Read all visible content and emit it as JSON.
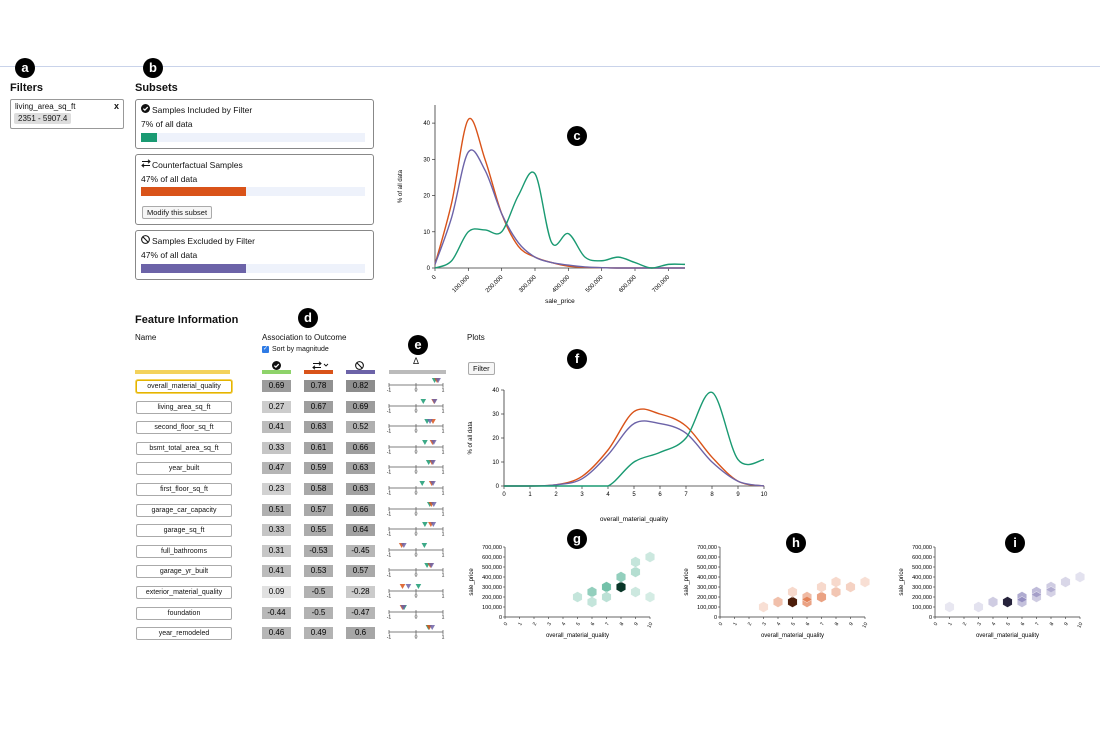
{
  "badges": {
    "a": "a",
    "b": "b",
    "c": "c",
    "d": "d",
    "e": "e",
    "f": "f",
    "g": "g",
    "h": "h",
    "i": "i"
  },
  "filters": {
    "title": "Filters",
    "item": {
      "name": "living_area_sq_ft",
      "range": "2351 - 5907.4",
      "close": "x"
    }
  },
  "subsets": {
    "title": "Subsets",
    "included": {
      "title": "Samples Included by Filter",
      "pct_label": "7% of all data",
      "pct": 7,
      "color": "#1a9a72"
    },
    "counterfactual": {
      "title": "Counterfactual Samples",
      "pct_label": "47% of all data",
      "pct": 47,
      "color": "#d95319",
      "button": "Modify this subset"
    },
    "excluded": {
      "title": "Samples Excluded by Filter",
      "pct_label": "47% of all data",
      "pct": 47,
      "color": "#6c63a8"
    }
  },
  "colors": {
    "included": "#1a9a72",
    "counterfactual": "#d95319",
    "excluded": "#6c63a8",
    "selected": "#f3d25c"
  },
  "feature_info": {
    "title": "Feature Information",
    "name_header": "Name",
    "assoc_header": "Association to Outcome",
    "sort_label": "Sort by magnitude",
    "sort_checked": true,
    "delta_header": "Δ",
    "plots_header": "Plots",
    "filter_button": "Filter",
    "included_icon": "check-circle-icon",
    "counterfactual_icon": "swap-arrows-icon",
    "excluded_icon": "ban-icon",
    "axis": {
      "min": "-1",
      "zero": "0",
      "max": "1"
    },
    "rows": [
      {
        "name": "overall_material_quality",
        "inc": "0.69",
        "cf": "0.78",
        "exc": "0.82"
      },
      {
        "name": "living_area_sq_ft",
        "inc": "0.27",
        "cf": "0.67",
        "exc": "0.69"
      },
      {
        "name": "second_floor_sq_ft",
        "inc": "0.41",
        "cf": "0.63",
        "exc": "0.52"
      },
      {
        "name": "bsmt_total_area_sq_ft",
        "inc": "0.33",
        "cf": "0.61",
        "exc": "0.66"
      },
      {
        "name": "year_built",
        "inc": "0.47",
        "cf": "0.59",
        "exc": "0.63"
      },
      {
        "name": "first_floor_sq_ft",
        "inc": "0.23",
        "cf": "0.58",
        "exc": "0.63"
      },
      {
        "name": "garage_car_capacity",
        "inc": "0.51",
        "cf": "0.57",
        "exc": "0.66"
      },
      {
        "name": "garage_sq_ft",
        "inc": "0.33",
        "cf": "0.55",
        "exc": "0.64"
      },
      {
        "name": "full_bathrooms",
        "inc": "0.31",
        "cf": "-0.53",
        "exc": "-0.45"
      },
      {
        "name": "garage_yr_built",
        "inc": "0.41",
        "cf": "0.53",
        "exc": "0.57"
      },
      {
        "name": "exterior_material_quality",
        "inc": "0.09",
        "cf": "-0.5",
        "exc": "-0.28"
      },
      {
        "name": "foundation",
        "inc": "-0.44",
        "cf": "-0.5",
        "exc": "-0.47"
      },
      {
        "name": "year_remodeled",
        "inc": "0.46",
        "cf": "0.49",
        "exc": "0.6"
      }
    ]
  },
  "chart_data": [
    {
      "type": "line",
      "xlabel": "sale_price",
      "ylabel": "% of all data",
      "xlim": [
        0,
        750000
      ],
      "ylim": [
        0,
        45
      ],
      "x_ticks": [
        "0",
        "100,000",
        "200,000",
        "300,000",
        "400,000",
        "500,000",
        "600,000",
        "700,000"
      ],
      "y_ticks": [
        "0",
        "10",
        "20",
        "30",
        "40"
      ],
      "x": [
        0,
        50000,
        100000,
        150000,
        200000,
        250000,
        300000,
        350000,
        400000,
        450000,
        500000,
        550000,
        600000,
        650000,
        700000,
        750000
      ],
      "series": [
        {
          "color": "#d95319",
          "values": [
            1,
            18,
            41,
            30,
            15,
            6,
            3,
            1.5,
            0.5,
            0.2,
            0.1,
            0,
            0,
            0,
            0,
            0
          ]
        },
        {
          "color": "#6c63a8",
          "values": [
            1,
            14,
            32,
            27,
            15,
            7,
            3,
            1.5,
            0.8,
            0.3,
            0.1,
            0,
            0,
            0,
            0,
            0
          ]
        },
        {
          "color": "#1a9a72",
          "values": [
            0,
            2,
            10,
            10.5,
            10,
            20,
            26,
            7,
            9.5,
            3,
            2,
            3,
            1.5,
            0,
            1,
            1
          ]
        }
      ]
    },
    {
      "type": "line",
      "xlabel": "overall_material_quality",
      "ylabel": "% of all data",
      "xlim": [
        0,
        10
      ],
      "ylim": [
        0,
        40
      ],
      "x_ticks": [
        "0",
        "1",
        "2",
        "3",
        "4",
        "5",
        "6",
        "7",
        "8",
        "9",
        "10"
      ],
      "y_ticks": [
        "0",
        "10",
        "20",
        "30",
        "40"
      ],
      "x": [
        0,
        1,
        2,
        3,
        4,
        5,
        6,
        7,
        8,
        9,
        10
      ],
      "series": [
        {
          "color": "#d95319",
          "values": [
            0,
            0,
            0.5,
            4,
            15,
            31,
            30,
            25,
            12,
            2,
            0
          ]
        },
        {
          "color": "#6c63a8",
          "values": [
            0,
            0,
            0.5,
            3,
            13,
            26,
            26,
            22,
            10,
            2,
            0
          ]
        },
        {
          "color": "#1a9a72",
          "values": [
            0,
            0,
            0,
            0,
            0,
            10,
            14,
            20,
            39,
            11,
            11
          ]
        }
      ]
    },
    {
      "type": "heatmap",
      "color": "#1a9a72",
      "xlabel": "overall_material_quality",
      "ylabel": "sale_price",
      "xlim": [
        0,
        10
      ],
      "ylim": [
        0,
        700000
      ],
      "x_ticks": [
        "0",
        "1",
        "2",
        "3",
        "4",
        "5",
        "6",
        "7",
        "8",
        "9",
        "10"
      ],
      "y_ticks": [
        "0",
        "100,000",
        "200,000",
        "300,000",
        "400,000",
        "500,000",
        "600,000",
        "700,000"
      ],
      "cells": [
        {
          "x": 5,
          "y": 200000,
          "v": 0.2
        },
        {
          "x": 6,
          "y": 250000,
          "v": 0.5
        },
        {
          "x": 7,
          "y": 300000,
          "v": 0.7
        },
        {
          "x": 8,
          "y": 300000,
          "v": 1.0
        },
        {
          "x": 8,
          "y": 400000,
          "v": 0.5
        },
        {
          "x": 9,
          "y": 450000,
          "v": 0.3
        },
        {
          "x": 9,
          "y": 550000,
          "v": 0.2
        },
        {
          "x": 10,
          "y": 600000,
          "v": 0.15
        },
        {
          "x": 7,
          "y": 200000,
          "v": 0.25
        },
        {
          "x": 6,
          "y": 150000,
          "v": 0.2
        },
        {
          "x": 9,
          "y": 250000,
          "v": 0.15
        },
        {
          "x": 10,
          "y": 200000,
          "v": 0.1
        }
      ]
    },
    {
      "type": "heatmap",
      "color": "#d95319",
      "xlabel": "overall_material_quality",
      "ylabel": "sale_price",
      "xlim": [
        0,
        10
      ],
      "ylim": [
        0,
        700000
      ],
      "x_ticks": [
        "0",
        "1",
        "2",
        "3",
        "4",
        "5",
        "6",
        "7",
        "8",
        "9",
        "10"
      ],
      "y_ticks": [
        "0",
        "100,000",
        "200,000",
        "300,000",
        "400,000",
        "500,000",
        "600,000",
        "700,000"
      ],
      "cells": [
        {
          "x": 3,
          "y": 100000,
          "v": 0.1
        },
        {
          "x": 4,
          "y": 150000,
          "v": 0.35
        },
        {
          "x": 5,
          "y": 150000,
          "v": 1.0
        },
        {
          "x": 6,
          "y": 150000,
          "v": 0.6
        },
        {
          "x": 6,
          "y": 200000,
          "v": 0.4
        },
        {
          "x": 7,
          "y": 200000,
          "v": 0.6
        },
        {
          "x": 8,
          "y": 250000,
          "v": 0.3
        },
        {
          "x": 9,
          "y": 300000,
          "v": 0.2
        },
        {
          "x": 10,
          "y": 350000,
          "v": 0.1
        },
        {
          "x": 7,
          "y": 300000,
          "v": 0.15
        },
        {
          "x": 8,
          "y": 350000,
          "v": 0.15
        },
        {
          "x": 5,
          "y": 250000,
          "v": 0.15
        }
      ]
    },
    {
      "type": "heatmap",
      "color": "#6c63a8",
      "xlabel": "overall_material_quality",
      "ylabel": "sale_price",
      "xlim": [
        0,
        10
      ],
      "ylim": [
        0,
        700000
      ],
      "x_ticks": [
        "0",
        "1",
        "2",
        "3",
        "4",
        "5",
        "6",
        "7",
        "8",
        "9",
        "10"
      ],
      "y_ticks": [
        "0",
        "100,000",
        "200,000",
        "300,000",
        "400,000",
        "500,000",
        "600,000",
        "700,000"
      ],
      "cells": [
        {
          "x": 1,
          "y": 100000,
          "v": 0.05
        },
        {
          "x": 3,
          "y": 100000,
          "v": 0.1
        },
        {
          "x": 4,
          "y": 150000,
          "v": 0.3
        },
        {
          "x": 5,
          "y": 150000,
          "v": 1.0
        },
        {
          "x": 6,
          "y": 200000,
          "v": 0.6
        },
        {
          "x": 7,
          "y": 250000,
          "v": 0.45
        },
        {
          "x": 8,
          "y": 300000,
          "v": 0.3
        },
        {
          "x": 9,
          "y": 350000,
          "v": 0.2
        },
        {
          "x": 10,
          "y": 400000,
          "v": 0.1
        },
        {
          "x": 6,
          "y": 150000,
          "v": 0.4
        },
        {
          "x": 7,
          "y": 200000,
          "v": 0.3
        },
        {
          "x": 8,
          "y": 250000,
          "v": 0.25
        }
      ]
    }
  ]
}
